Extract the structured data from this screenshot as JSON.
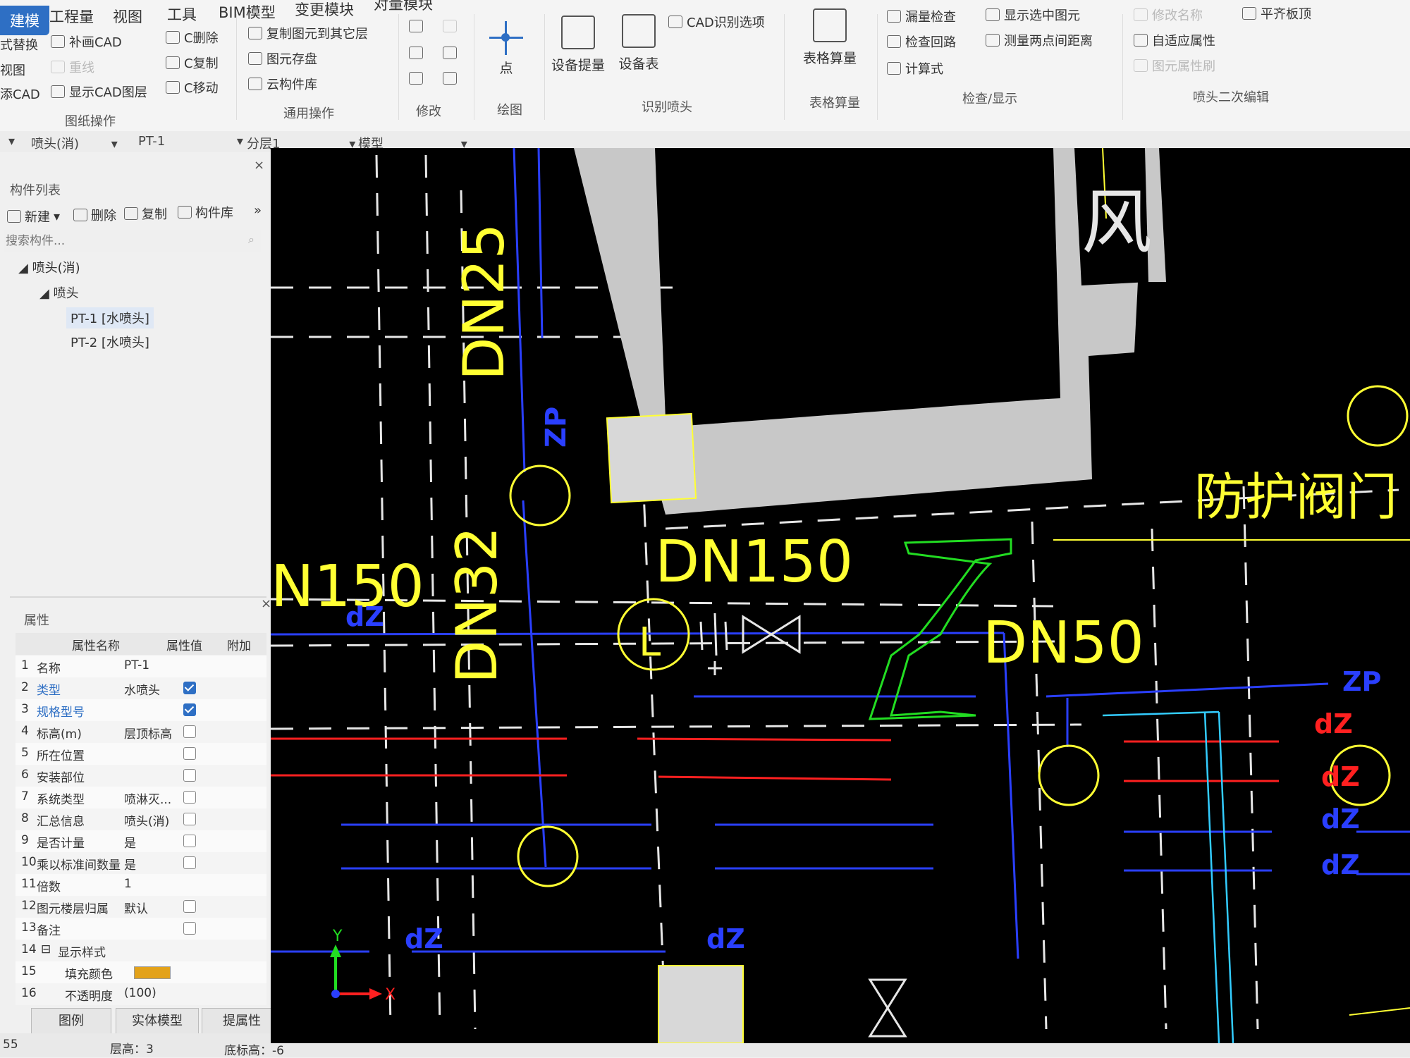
{
  "ribbon": {
    "tabs": [
      "建模",
      "工程量",
      "视图",
      "工具",
      "BIM模型",
      "变更模块",
      "对量模块"
    ],
    "left_col": [
      "式替换",
      "视图",
      "添CAD"
    ],
    "buttons": {
      "patch_cad": "补画CAD",
      "redraw": "重线",
      "show_cad_layer": "显示CAD图层",
      "c_delete": "C删除",
      "c_copy": "C复制",
      "c_move": "C移动",
      "copy_to_layer": "复制图元到其它层",
      "store_elements": "图元存盘",
      "cloud_library": "云构件库",
      "cad_options": "CAD识别选项",
      "leak_check": "漏量检查",
      "check_loop": "检查回路",
      "formula": "计算式",
      "show_selected": "显示选中图元",
      "measure_two_points": "测量两点间距离",
      "edit_name": "修改名称",
      "adaptive_props": "自适应属性",
      "element_props": "图元属性刷",
      "flush_slab": "平齐板顶"
    },
    "big_buttons": {
      "point": "点",
      "device_extract": "设备提量",
      "device_table": "设备表",
      "table_calc": "表格算量"
    },
    "groups": {
      "drawing_ops": "图纸操作",
      "general_ops": "通用操作",
      "modify": "修改",
      "draw": "绘图",
      "identify_sprinkler": "识别喷头",
      "table_calc": "表格算量",
      "check_display": "检查/显示",
      "sprinkler_edit": "喷头二次编辑"
    }
  },
  "selector": {
    "category": "喷头(消)",
    "component": "PT-1",
    "layer": "分层1",
    "mode": "模型"
  },
  "component_list": {
    "title": "构件列表",
    "toolbar": {
      "new": "新建",
      "delete": "删除",
      "copy": "复制",
      "library": "构件库"
    },
    "search_placeholder": "搜索构件...",
    "tree": {
      "root": "喷头(消)",
      "group": "喷头",
      "items": [
        "PT-1 [水喷头]",
        "PT-2 [水喷头]"
      ]
    }
  },
  "properties": {
    "title": "属性",
    "headers": [
      "属性名称",
      "属性值",
      "附加"
    ],
    "rows": [
      {
        "n": "1",
        "name": "名称",
        "value": "PT-1",
        "cb": "none"
      },
      {
        "n": "2",
        "name": "类型",
        "value": "水喷头",
        "cb": "on"
      },
      {
        "n": "3",
        "name": "规格型号",
        "value": "",
        "cb": "on"
      },
      {
        "n": "4",
        "name": "标高(m)",
        "value": "层顶标高",
        "cb": "off"
      },
      {
        "n": "5",
        "name": "所在位置",
        "value": "",
        "cb": "off"
      },
      {
        "n": "6",
        "name": "安装部位",
        "value": "",
        "cb": "off"
      },
      {
        "n": "7",
        "name": "系统类型",
        "value": "喷淋灭...",
        "cb": "off"
      },
      {
        "n": "8",
        "name": "汇总信息",
        "value": "喷头(消)",
        "cb": "off"
      },
      {
        "n": "9",
        "name": "是否计量",
        "value": "是",
        "cb": "off"
      },
      {
        "n": "10",
        "name": "乘以标准间数量",
        "value": "是",
        "cb": "off"
      },
      {
        "n": "11",
        "name": "倍数",
        "value": "1",
        "cb": "none"
      },
      {
        "n": "12",
        "name": "图元楼层归属",
        "value": "默认",
        "cb": "off"
      },
      {
        "n": "13",
        "name": "备注",
        "value": "",
        "cb": "off"
      },
      {
        "n": "14",
        "name": "显示样式",
        "value": "",
        "cb": "none"
      },
      {
        "n": "15",
        "name": "填充颜色",
        "value": "",
        "cb": "none"
      },
      {
        "n": "16",
        "name": "不透明度",
        "value": "(100)",
        "cb": "none"
      }
    ],
    "fill_color": "#e3a21a"
  },
  "bottom_buttons": {
    "legend": "图例",
    "solid_model": "实体模型",
    "extract_props": "提属性"
  },
  "status": {
    "left": "55",
    "floor_height": "层高：3",
    "base_elev": "底标高：-6"
  },
  "cad": {
    "labels": {
      "dn25": "DN25",
      "dn32": "DN32",
      "dn150_top": "DN150",
      "dn150_left": "N150",
      "dn50": "DN50",
      "zp_v": "ZP",
      "zp_h": "ZP",
      "dz": "dZ",
      "l": "L",
      "feng": "风",
      "valve_text": "防护阀门"
    },
    "colors": {
      "yellow": "#ffff33",
      "blue": "#2a3fff",
      "red": "#ff2020",
      "green": "#22dd22",
      "white": "#e6e6e6",
      "cyan": "#33ccff",
      "gray": "#c8c8c8"
    }
  }
}
